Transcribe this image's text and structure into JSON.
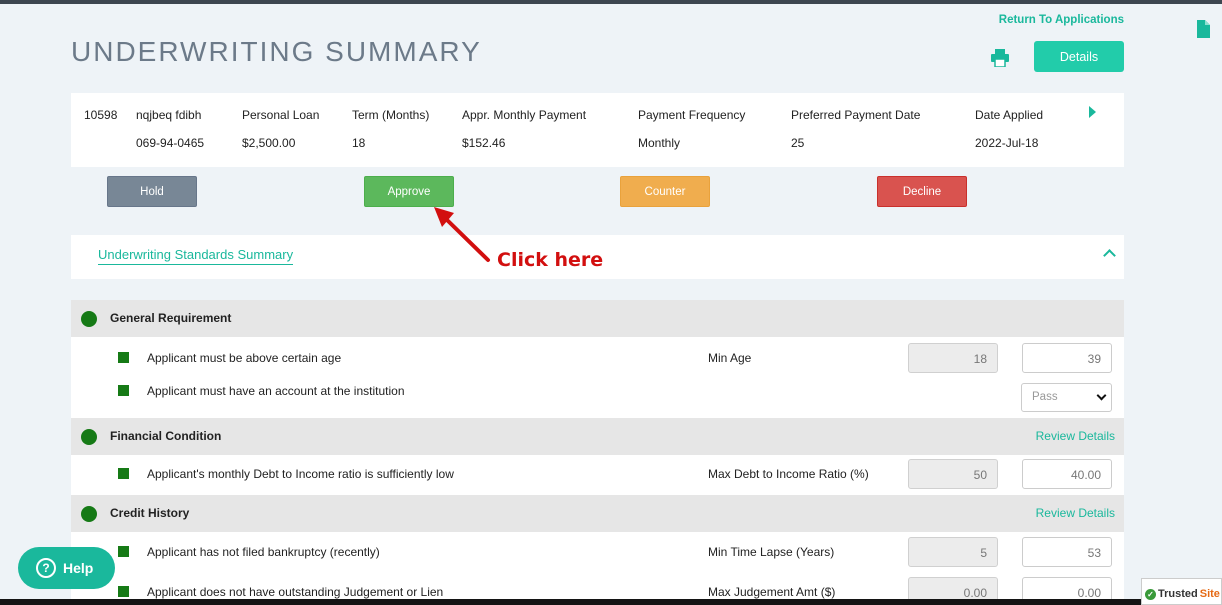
{
  "header": {
    "return_link": "Return To Applications",
    "title": "UNDERWRITING SUMMARY",
    "details_button": "Details"
  },
  "application": {
    "id": "10598",
    "name": "nqjbeq fdibh",
    "ssn": "069-94-0465",
    "columns": [
      {
        "label": "Personal Loan",
        "value": "$2,500.00"
      },
      {
        "label": "Term (Months)",
        "value": "18"
      },
      {
        "label": "Appr. Monthly Payment",
        "value": "$152.46"
      },
      {
        "label": "Payment Frequency",
        "value": "Monthly"
      },
      {
        "label": "Preferred Payment Date",
        "value": "25"
      },
      {
        "label": "Date Applied",
        "value": "2022-Jul-18"
      }
    ]
  },
  "actions": {
    "hold": "Hold",
    "approve": "Approve",
    "counter": "Counter",
    "decline": "Decline"
  },
  "annotation": {
    "text": "Click here"
  },
  "standards": {
    "link": "Underwriting Standards Summary",
    "sections": [
      {
        "title": "General Requirement",
        "review": "",
        "rows": [
          {
            "text": "Applicant must be above certain age",
            "metric": "Min Age",
            "standard": "18",
            "value": "39"
          },
          {
            "text": "Applicant must have an account at the institution",
            "metric": "",
            "select": "Pass"
          }
        ]
      },
      {
        "title": "Financial Condition",
        "review": "Review Details",
        "rows": [
          {
            "text": "Applicant's monthly Debt to Income ratio is sufficiently low",
            "metric": "Max Debt to Income Ratio (%)",
            "standard": "50",
            "value": "40.00"
          }
        ]
      },
      {
        "title": "Credit History",
        "review": "Review Details",
        "rows": [
          {
            "text": "Applicant has not filed bankruptcy (recently)",
            "metric": "Min Time Lapse (Years)",
            "standard": "5",
            "value": "53"
          },
          {
            "text": "Applicant does not have outstanding Judgement or Lien",
            "metric": "Max Judgement Amt ($)",
            "standard": "0.00",
            "value": "0.00"
          }
        ]
      }
    ]
  },
  "help": {
    "label": "Help"
  },
  "trusted_site": {
    "left": "Trusted",
    "right": "Site"
  },
  "colors": {
    "accent": "#1ab89c",
    "status_pass": "#167a16",
    "hold": "#788796",
    "approve": "#5cb85c",
    "counter": "#f0ad4e",
    "decline": "#d9534f",
    "annotation": "#d20f0f"
  }
}
